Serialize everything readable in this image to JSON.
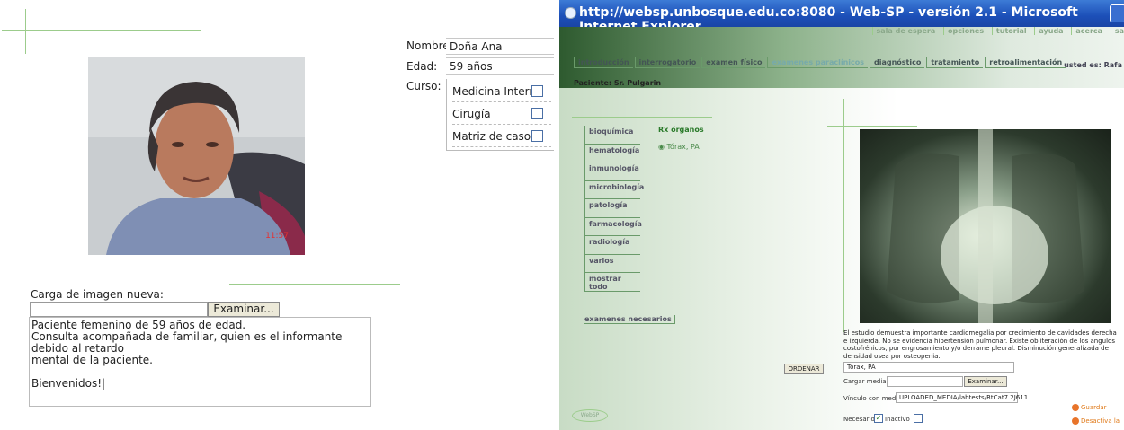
{
  "left_form": {
    "nombre_label": "Nombre:",
    "nombre_value": "Doña Ana",
    "edad_label": "Edad:",
    "edad_value": "59 años",
    "curso_label": "Curso:",
    "curso_options": [
      {
        "label": "Medicina Interna",
        "checked": false
      },
      {
        "label": "Cirugía",
        "checked": false
      },
      {
        "label": "Matriz de caso",
        "checked": false
      }
    ],
    "photo_timestamp": "11:57",
    "carga_label": "Carga de imagen nueva:",
    "examinar_button": "Examinar...",
    "description": "Paciente femenino de 59 años de edad.\nConsulta acompañada de familiar, quien es el informante debido al retardo\nmental de la paciente.\n\nBienvenidos!|"
  },
  "ie_window": {
    "title": "http://websp.unbosque.edu.co:8080 - Web-SP - versión 2.1 - Microsoft Internet Explorer",
    "top_links": [
      "sala de espera",
      "opciones",
      "tutorial",
      "ayuda",
      "acerca",
      "sa"
    ],
    "nav_tabs": [
      "introducción",
      "interrogatorio",
      "examen físico",
      "examenes paraclínicos",
      "diagnóstico",
      "tratamiento",
      "retroalimentación"
    ],
    "active_tab": "examenes paraclínicos",
    "usuario": "usted es: Rafa",
    "paciente": "Paciente: Sr. Pulgarin",
    "side_menu": [
      "bioquímica",
      "hematología",
      "inmunología",
      "microbiología",
      "patología",
      "farmacología",
      "radiología",
      "varios",
      "mostrar todo"
    ],
    "rx_header": "Rx órganos",
    "rx_item": "Tórax, PA",
    "examenes_necesarios": "examenes necesarios",
    "ordenar_button": "ORDENAR",
    "report": "El estudio demuestra importante cardiomegalia por crecimiento de cavidades derecha e izquierda. No se evidencia hipertensión pulmonar. Existe obliteración de los angulos costofrénicos, por engrosamiento y/o derrame pleural. Disminución generalizada de densidad osea por osteopenia.",
    "media_name": "Tórax, PA",
    "cargar_media_label": "Cargar media:",
    "examinar_button": "Examinar...",
    "vinculo_label": "Vínculo con media:",
    "vinculo_value": "UPLOADED_MEDIA/labtests/RtCat7.2J611",
    "necesario_label": "Necesario",
    "necesario_checked": true,
    "inactivo_label": "Inactivo",
    "inactivo_checked": false,
    "guardar_link": "Guardar",
    "desactivar_link": "Desactiva la",
    "logo_text": "WebSP"
  }
}
